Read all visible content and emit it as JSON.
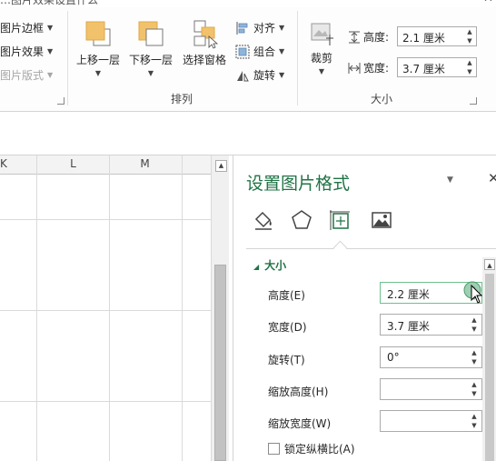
{
  "title_partial": "…图片效果设置什么",
  "ribbon": {
    "picture_styles": {
      "border": "图片边框",
      "effects": "图片效果",
      "layout": "图片版式"
    },
    "arrange": {
      "bring_forward": "上移一层",
      "send_backward": "下移一层",
      "selection_pane": "选择窗格",
      "align": "对齐",
      "group": "组合",
      "rotate": "旋转",
      "label": "排列"
    },
    "size": {
      "crop": "裁剪",
      "height_label": "高度:",
      "height_value": "2.1 厘米",
      "width_label": "宽度:",
      "width_value": "3.7 厘米",
      "label": "大小"
    }
  },
  "sheet": {
    "columns": [
      "K",
      "L",
      "M"
    ]
  },
  "pane": {
    "title": "设置图片格式",
    "tabs": [
      "fill-line-icon",
      "effects-icon",
      "size-properties-icon",
      "picture-icon"
    ],
    "section": "大小",
    "fields": [
      {
        "label": "高度(E)",
        "value": "2.2 厘米"
      },
      {
        "label": "宽度(D)",
        "value": "3.7 厘米"
      },
      {
        "label": "旋转(T)",
        "value": "0°"
      },
      {
        "label": "缩放高度(H)",
        "value": ""
      },
      {
        "label": "缩放宽度(W)",
        "value": ""
      }
    ],
    "lock_aspect": "锁定纵横比(A)"
  },
  "colors": {
    "accent_green": "#217346",
    "ribbon_bg": "#fdfdfd",
    "border": "#ababab"
  }
}
